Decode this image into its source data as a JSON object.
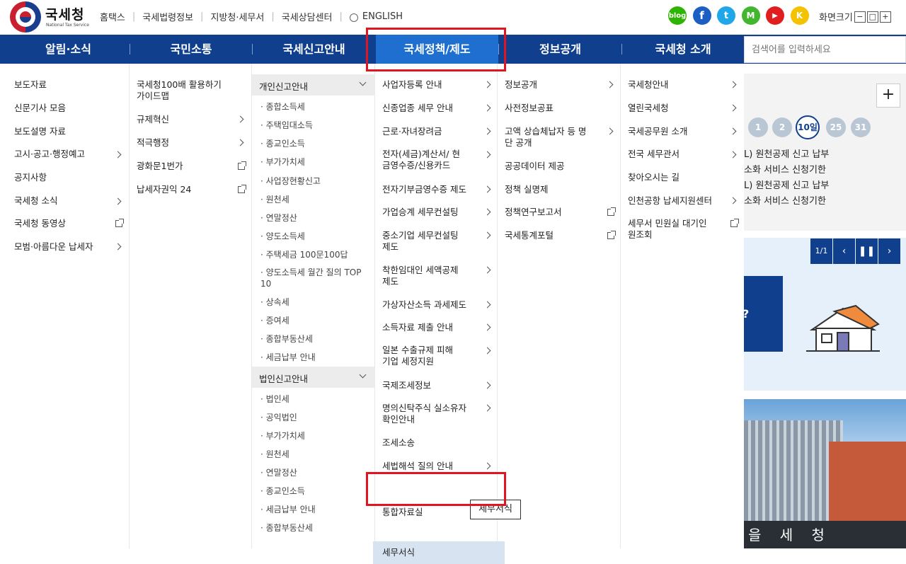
{
  "header": {
    "logo_title": "국세청",
    "logo_subtitle": "National Tax Service",
    "util_links": [
      "홈택스",
      "국세법령정보",
      "지방청·세무서",
      "국세상담센터",
      "ENGLISH"
    ],
    "sns": [
      "blog",
      "f",
      "t",
      "M",
      "▶",
      "K"
    ],
    "font_size_label": "화면크기",
    "font_buttons": [
      "−",
      "□",
      "+"
    ]
  },
  "gnb": {
    "items": [
      "알림·소식",
      "국민소통",
      "국세신고안내",
      "국세정책/제도",
      "정보공개",
      "국세청 소개"
    ],
    "search_placeholder": "검색어를 입력하세요"
  },
  "menu": {
    "col1": [
      "보도자료",
      "신문기사 모음",
      "보도설명 자료",
      "고시·공고·행정예고",
      "공지사항",
      "국세청 소식",
      "국세청 동영상",
      "모범·아름다운 납세자"
    ],
    "col2": [
      "국세청100배 활용하기 가이드맵",
      "규제혁신",
      "적극행정",
      "광화문1번가",
      "납세자권익 24"
    ],
    "col3_head1": "개인신고안내",
    "col3_sub1": [
      "종합소득세",
      "주택임대소득",
      "종교인소득",
      "부가가치세",
      "사업장현황신고",
      "원천세",
      "연말정산",
      "양도소득세",
      "주택세금 100문100답",
      "양도소득세 월간 질의 TOP 10",
      "상속세",
      "증여세",
      "종합부동산세",
      "세금납부 안내"
    ],
    "col3_head2": "법인신고안내",
    "col3_sub2": [
      "법인세",
      "공익법인",
      "부가가치세",
      "원천세",
      "연말정산",
      "종교인소득",
      "세금납부 안내",
      "종합부동산세"
    ],
    "col4": [
      "사업자등록 안내",
      "신종업종 세무 안내",
      "근로·자녀장려금",
      "전자(세금)계산서/ 현금영수증/신용카드",
      "전자기부금영수증 제도",
      "가업승계 세무컨설팅",
      "중소기업 세무컨설팅 제도",
      "착한임대인 세액공제 제도",
      "가상자산소득 과세제도",
      "소득자료 제출 안내",
      "일본 수출규제 피해기업 세정지원",
      "국제조세정보",
      "명의신탁주식 실소유자 확인안내",
      "조세소송",
      "세법해석 질의 안내",
      "세무서식",
      "통합자료실"
    ],
    "col5": [
      "정보공개",
      "사전정보공표",
      "고액 상습체납자 등 명단 공개",
      "공공데이터 제공",
      "정책 실명제",
      "정책연구보고서",
      "국세통계포털"
    ],
    "col6": [
      "국세청안내",
      "열린국세청",
      "국세공무원 소개",
      "전국 세무관서",
      "찾아오시는 길",
      "인천공항 납세지원센터",
      "세무서 민원실 대기인원조회"
    ],
    "tooltip": "세무서식"
  },
  "right_panel": {
    "dates": [
      "1",
      "2",
      "10일",
      "25",
      "31"
    ],
    "notices": [
      "L) 원천공제 신고 납부",
      "소화 서비스 신청기한",
      "L) 원천공제 신고 납부",
      "소화 서비스 신청기한"
    ],
    "page_indicator": "1/1",
    "banner_text": "?",
    "building_text": "을 세 청"
  },
  "colors": {
    "nav": "#103f8e",
    "active": "#1e6fd0",
    "highlight": "#d7e3f0",
    "outline": "#e2141f"
  }
}
